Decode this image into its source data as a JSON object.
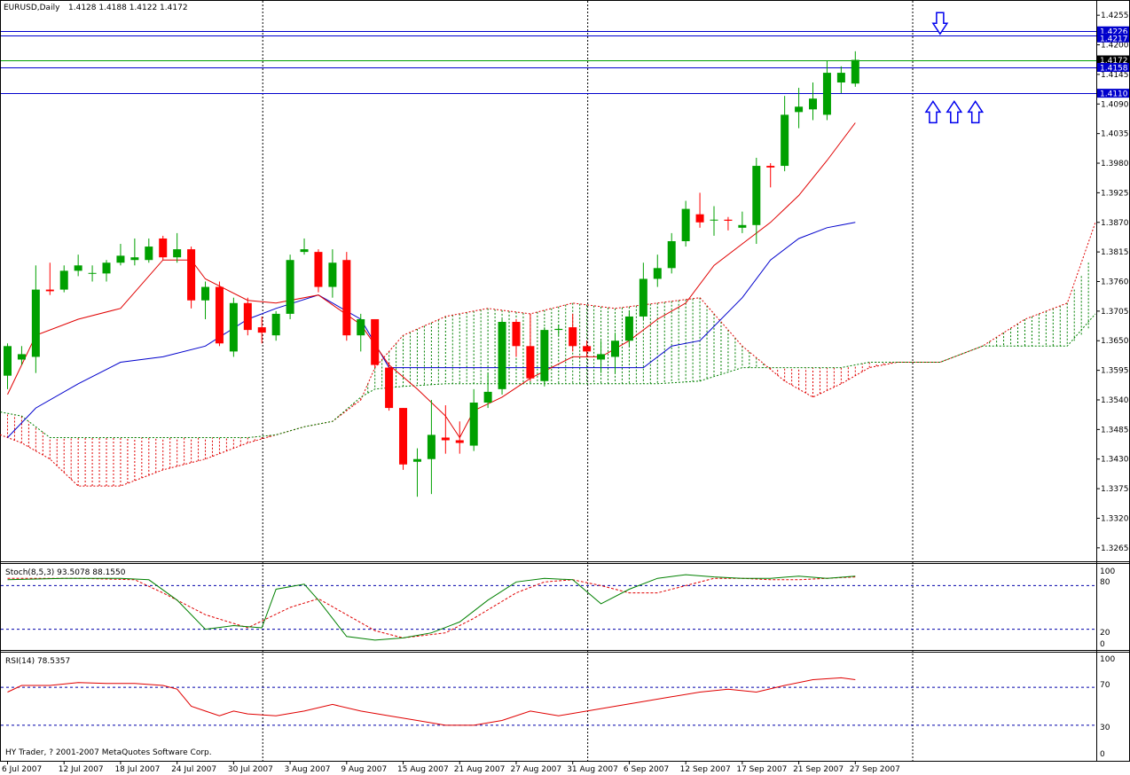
{
  "header": {
    "symbol": "EURUSD,Daily",
    "ohlc": "1.4128 1.4188 1.4122 1.4172"
  },
  "footer": {
    "copyright": "HY Trader, ? 2001-2007 MetaQuotes Software Corp."
  },
  "indicators": {
    "stoch": {
      "label": "Stoch(8,5,3) 93.5078 88.1550",
      "levels_shown": [
        "100",
        "80",
        "20",
        "0"
      ]
    },
    "rsi": {
      "label": "RSI(14) 78.5357",
      "levels_shown": [
        "100",
        "70",
        "30",
        "0"
      ]
    }
  },
  "price_axis_ticks": [
    "1.4255",
    "1.4200",
    "1.4145",
    "1.4090",
    "1.4035",
    "1.3980",
    "1.3925",
    "1.3870",
    "1.3815",
    "1.3760",
    "1.3705",
    "1.3650",
    "1.3595",
    "1.3540",
    "1.3485",
    "1.3430",
    "1.3375",
    "1.3320",
    "1.3265"
  ],
  "price_tags": [
    {
      "value": "1.4226",
      "color": "#0000cc"
    },
    {
      "value": "1.4217",
      "color": "#0000cc"
    },
    {
      "value": "1.4172",
      "color": "#000000"
    },
    {
      "value": "1.4158",
      "color": "#0000cc"
    },
    {
      "value": "1.4110",
      "color": "#0000cc"
    }
  ],
  "date_labels": [
    "6 Jul 2007",
    "12 Jul 2007",
    "18 Jul 2007",
    "24 Jul 2007",
    "30 Jul 2007",
    "3 Aug 2007",
    "9 Aug 2007",
    "15 Aug 2007",
    "21 Aug 2007",
    "27 Aug 2007",
    "31 Aug 2007",
    "6 Sep 2007",
    "12 Sep 2007",
    "17 Sep 2007",
    "21 Sep 2007",
    "27 Sep 2007"
  ],
  "colors": {
    "bull": "#00a000",
    "bear": "#ff0000",
    "tenkan": "#e00000",
    "kijun": "#0000cc",
    "cloud_red": "#e00000",
    "cloud_green": "#008000",
    "hlines": "#0000cc",
    "axis": "#000000"
  },
  "chart_data": {
    "type": "candlestick",
    "title": "EURUSD,Daily",
    "y_range": [
      1.324,
      1.428
    ],
    "candles": [
      {
        "o": 1.3585,
        "h": 1.3645,
        "l": 1.356,
        "c": 1.364
      },
      {
        "o": 1.3615,
        "h": 1.364,
        "l": 1.3605,
        "c": 1.3625
      },
      {
        "o": 1.362,
        "h": 1.379,
        "l": 1.359,
        "c": 1.3745
      },
      {
        "o": 1.3745,
        "h": 1.3795,
        "l": 1.3735,
        "c": 1.3742
      },
      {
        "o": 1.3745,
        "h": 1.379,
        "l": 1.374,
        "c": 1.378
      },
      {
        "o": 1.378,
        "h": 1.381,
        "l": 1.377,
        "c": 1.379
      },
      {
        "o": 1.3776,
        "h": 1.379,
        "l": 1.376,
        "c": 1.3776
      },
      {
        "o": 1.3775,
        "h": 1.38,
        "l": 1.376,
        "c": 1.3795
      },
      {
        "o": 1.3795,
        "h": 1.383,
        "l": 1.379,
        "c": 1.3808
      },
      {
        "o": 1.38,
        "h": 1.384,
        "l": 1.379,
        "c": 1.3805
      },
      {
        "o": 1.38,
        "h": 1.384,
        "l": 1.3795,
        "c": 1.3825
      },
      {
        "o": 1.384,
        "h": 1.3845,
        "l": 1.38,
        "c": 1.3805
      },
      {
        "o": 1.3805,
        "h": 1.385,
        "l": 1.3795,
        "c": 1.382
      },
      {
        "o": 1.382,
        "h": 1.3825,
        "l": 1.371,
        "c": 1.3725
      },
      {
        "o": 1.3725,
        "h": 1.376,
        "l": 1.369,
        "c": 1.375
      },
      {
        "o": 1.375,
        "h": 1.376,
        "l": 1.364,
        "c": 1.3645
      },
      {
        "o": 1.363,
        "h": 1.373,
        "l": 1.362,
        "c": 1.372
      },
      {
        "o": 1.372,
        "h": 1.373,
        "l": 1.366,
        "c": 1.367
      },
      {
        "o": 1.3675,
        "h": 1.3695,
        "l": 1.3645,
        "c": 1.3665
      },
      {
        "o": 1.366,
        "h": 1.3705,
        "l": 1.365,
        "c": 1.37
      },
      {
        "o": 1.37,
        "h": 1.381,
        "l": 1.369,
        "c": 1.38
      },
      {
        "o": 1.3815,
        "h": 1.384,
        "l": 1.381,
        "c": 1.382
      },
      {
        "o": 1.3815,
        "h": 1.382,
        "l": 1.374,
        "c": 1.375
      },
      {
        "o": 1.375,
        "h": 1.382,
        "l": 1.373,
        "c": 1.3795
      },
      {
        "o": 1.38,
        "h": 1.3815,
        "l": 1.365,
        "c": 1.366
      },
      {
        "o": 1.366,
        "h": 1.37,
        "l": 1.363,
        "c": 1.369
      },
      {
        "o": 1.369,
        "h": 1.369,
        "l": 1.36,
        "c": 1.3605
      },
      {
        "o": 1.36,
        "h": 1.361,
        "l": 1.352,
        "c": 1.3525
      },
      {
        "o": 1.3525,
        "h": 1.3525,
        "l": 1.341,
        "c": 1.342
      },
      {
        "o": 1.3425,
        "h": 1.345,
        "l": 1.336,
        "c": 1.343
      },
      {
        "o": 1.343,
        "h": 1.354,
        "l": 1.3365,
        "c": 1.3475
      },
      {
        "o": 1.347,
        "h": 1.353,
        "l": 1.344,
        "c": 1.3465
      },
      {
        "o": 1.3465,
        "h": 1.35,
        "l": 1.344,
        "c": 1.346
      },
      {
        "o": 1.3455,
        "h": 1.356,
        "l": 1.3445,
        "c": 1.3535
      },
      {
        "o": 1.3535,
        "h": 1.359,
        "l": 1.3525,
        "c": 1.3555
      },
      {
        "o": 1.356,
        "h": 1.369,
        "l": 1.355,
        "c": 1.3685
      },
      {
        "o": 1.3685,
        "h": 1.369,
        "l": 1.362,
        "c": 1.364
      },
      {
        "o": 1.364,
        "h": 1.37,
        "l": 1.3575,
        "c": 1.358
      },
      {
        "o": 1.3575,
        "h": 1.3675,
        "l": 1.3565,
        "c": 1.367
      },
      {
        "o": 1.367,
        "h": 1.368,
        "l": 1.366,
        "c": 1.3672
      },
      {
        "o": 1.3675,
        "h": 1.37,
        "l": 1.363,
        "c": 1.364
      },
      {
        "o": 1.364,
        "h": 1.365,
        "l": 1.362,
        "c": 1.363
      },
      {
        "o": 1.3615,
        "h": 1.365,
        "l": 1.359,
        "c": 1.3625
      },
      {
        "o": 1.362,
        "h": 1.3665,
        "l": 1.359,
        "c": 1.365
      },
      {
        "o": 1.365,
        "h": 1.3705,
        "l": 1.364,
        "c": 1.3695
      },
      {
        "o": 1.3695,
        "h": 1.3795,
        "l": 1.369,
        "c": 1.3765
      },
      {
        "o": 1.3765,
        "h": 1.381,
        "l": 1.375,
        "c": 1.3785
      },
      {
        "o": 1.3785,
        "h": 1.385,
        "l": 1.3775,
        "c": 1.3835
      },
      {
        "o": 1.3835,
        "h": 1.391,
        "l": 1.3825,
        "c": 1.3895
      },
      {
        "o": 1.3885,
        "h": 1.3925,
        "l": 1.386,
        "c": 1.387
      },
      {
        "o": 1.3875,
        "h": 1.39,
        "l": 1.3845,
        "c": 1.3875
      },
      {
        "o": 1.3875,
        "h": 1.388,
        "l": 1.3855,
        "c": 1.3873
      },
      {
        "o": 1.386,
        "h": 1.389,
        "l": 1.385,
        "c": 1.3865
      },
      {
        "o": 1.3865,
        "h": 1.399,
        "l": 1.383,
        "c": 1.3975
      },
      {
        "o": 1.3975,
        "h": 1.398,
        "l": 1.3935,
        "c": 1.3972
      },
      {
        "o": 1.3975,
        "h": 1.4105,
        "l": 1.3965,
        "c": 1.407
      },
      {
        "o": 1.4075,
        "h": 1.412,
        "l": 1.4045,
        "c": 1.4085
      },
      {
        "o": 1.408,
        "h": 1.413,
        "l": 1.406,
        "c": 1.41
      },
      {
        "o": 1.407,
        "h": 1.417,
        "l": 1.406,
        "c": 1.4148
      },
      {
        "o": 1.413,
        "h": 1.416,
        "l": 1.411,
        "c": 1.4148
      },
      {
        "o": 1.4128,
        "h": 1.4188,
        "l": 1.4122,
        "c": 1.4172
      }
    ],
    "tenkan_x": [
      0,
      2,
      5,
      8,
      11,
      13,
      14,
      17,
      19,
      22,
      25,
      27,
      29,
      31,
      32,
      33,
      35,
      37,
      40,
      42,
      44,
      46,
      48,
      50,
      52,
      54,
      56,
      58,
      60
    ],
    "tenkan": [
      1.355,
      1.366,
      1.369,
      1.371,
      1.38,
      1.38,
      1.3765,
      1.3725,
      1.372,
      1.3735,
      1.368,
      1.3605,
      1.356,
      1.351,
      1.347,
      1.352,
      1.3545,
      1.358,
      1.362,
      1.362,
      1.365,
      1.369,
      1.372,
      1.379,
      1.383,
      1.387,
      1.392,
      1.3985,
      1.4055
    ],
    "kijun_x": [
      0,
      2,
      5,
      8,
      11,
      14,
      17,
      19,
      22,
      25,
      27,
      29,
      31,
      35,
      40,
      43,
      45,
      47,
      49,
      52,
      54,
      56,
      58,
      60
    ],
    "kijun": [
      1.347,
      1.3525,
      1.357,
      1.361,
      1.362,
      1.364,
      1.369,
      1.371,
      1.3735,
      1.369,
      1.36,
      1.36,
      1.36,
      1.36,
      1.36,
      1.36,
      1.36,
      1.364,
      1.365,
      1.373,
      1.38,
      1.384,
      1.386,
      1.387
    ],
    "spanA_x": [
      -1,
      1,
      3,
      5,
      8,
      11,
      14,
      17,
      19,
      21,
      23,
      25,
      26,
      28,
      31,
      34,
      37,
      40,
      43,
      46,
      49,
      52,
      55,
      57,
      59,
      61,
      63,
      66,
      69,
      72,
      75,
      78
    ],
    "spanA": [
      1.348,
      1.346,
      1.343,
      1.338,
      1.338,
      1.341,
      1.343,
      1.346,
      1.3475,
      1.349,
      1.35,
      1.354,
      1.36,
      1.366,
      1.3695,
      1.371,
      1.37,
      1.372,
      1.371,
      1.372,
      1.373,
      1.364,
      1.3575,
      1.3545,
      1.357,
      1.36,
      1.361,
      1.361,
      1.364,
      1.369,
      1.372,
      1.387
    ],
    "spanB_x": [
      -1,
      1,
      3,
      5,
      8,
      11,
      14,
      17,
      19,
      21,
      23,
      25,
      26,
      28,
      31,
      34,
      37,
      40,
      43,
      46,
      49,
      52,
      55,
      57,
      59,
      61,
      63,
      66,
      69,
      72,
      75,
      78
    ],
    "spanB": [
      1.352,
      1.351,
      1.347,
      1.347,
      1.347,
      1.347,
      1.347,
      1.347,
      1.3475,
      1.349,
      1.35,
      1.3545,
      1.356,
      1.3565,
      1.357,
      1.357,
      1.357,
      1.357,
      1.357,
      1.357,
      1.3575,
      1.36,
      1.36,
      1.36,
      1.36,
      1.361,
      1.361,
      1.361,
      1.364,
      1.364,
      1.364,
      1.37
    ],
    "horizontal_lines": [
      1.4226,
      1.4217,
      1.4172,
      1.4158,
      1.411
    ],
    "arrows": [
      {
        "dir": "down",
        "index": 66,
        "price": 1.424
      },
      {
        "dir": "up",
        "index": 65.5,
        "price": 1.4075
      },
      {
        "dir": "up",
        "index": 67.0,
        "price": 1.4075
      },
      {
        "dir": "up",
        "index": 68.5,
        "price": 1.4075
      }
    ],
    "stoch": {
      "range": [
        0,
        100
      ],
      "levels": [
        80,
        20
      ],
      "main_x": [
        0,
        4,
        8,
        10,
        12,
        14,
        16,
        18,
        19,
        21,
        22,
        24,
        26,
        28,
        30,
        32,
        34,
        36,
        38,
        40,
        42,
        44,
        46,
        48,
        50,
        52,
        54,
        56,
        58,
        60
      ],
      "main": [
        88,
        90,
        90,
        88,
        60,
        20,
        25,
        22,
        75,
        82,
        60,
        10,
        5,
        8,
        15,
        30,
        60,
        85,
        90,
        88,
        55,
        75,
        90,
        95,
        92,
        90,
        90,
        93,
        90,
        93
      ],
      "signal_x": [
        0,
        5,
        9,
        11,
        14,
        17,
        20,
        22,
        24,
        26,
        28,
        31,
        33,
        36,
        38,
        40,
        42,
        44,
        46,
        48,
        50,
        52,
        54,
        56,
        58,
        60
      ],
      "signal": [
        90,
        90,
        88,
        70,
        40,
        22,
        50,
        62,
        40,
        18,
        8,
        15,
        35,
        70,
        85,
        88,
        80,
        70,
        70,
        80,
        90,
        90,
        88,
        88,
        90,
        92
      ]
    },
    "rsi": {
      "range": [
        0,
        100
      ],
      "levels": [
        70,
        30
      ],
      "x": [
        0,
        1,
        3,
        5,
        7,
        9,
        11,
        12,
        13,
        14,
        15,
        16,
        17,
        19,
        21,
        23,
        25,
        27,
        29,
        31,
        33,
        35,
        37,
        39,
        41,
        43,
        45,
        47,
        49,
        51,
        53,
        55,
        57,
        59,
        60
      ],
      "y": [
        65,
        72,
        72,
        75,
        74,
        74,
        72,
        68,
        50,
        45,
        40,
        45,
        42,
        40,
        45,
        52,
        45,
        40,
        35,
        30,
        30,
        35,
        45,
        40,
        45,
        50,
        55,
        60,
        65,
        68,
        65,
        72,
        78,
        80,
        78
      ]
    }
  }
}
